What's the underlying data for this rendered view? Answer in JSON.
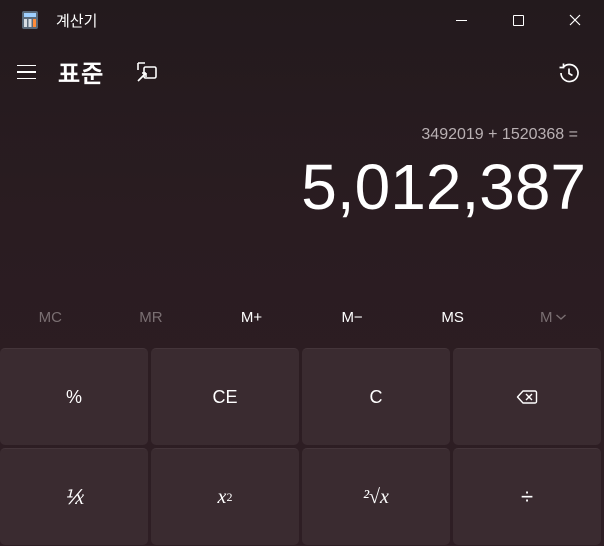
{
  "window": {
    "title": "계산기",
    "colors": {
      "background": "#2a1c21",
      "key": "#3a2b30",
      "disabled_text": "#7a6f72"
    }
  },
  "header": {
    "mode": "표준",
    "menu_icon": "hamburger-menu-icon",
    "keep_on_top_icon": "keep-on-top-icon",
    "history_icon": "history-icon"
  },
  "display": {
    "expression": "3492019 + 1520368 =",
    "result": "5,012,387"
  },
  "memory": {
    "mc": "MC",
    "mr": "MR",
    "mplus": "M+",
    "mminus": "M−",
    "ms": "MS",
    "mlist": "M"
  },
  "keys": {
    "percent": "%",
    "ce": "CE",
    "c": "C",
    "backspace_icon": "backspace-icon",
    "reciprocal": "⅟x",
    "square_base": "x",
    "square_exp": "2",
    "sqrt": "²√x",
    "divide": "÷"
  }
}
